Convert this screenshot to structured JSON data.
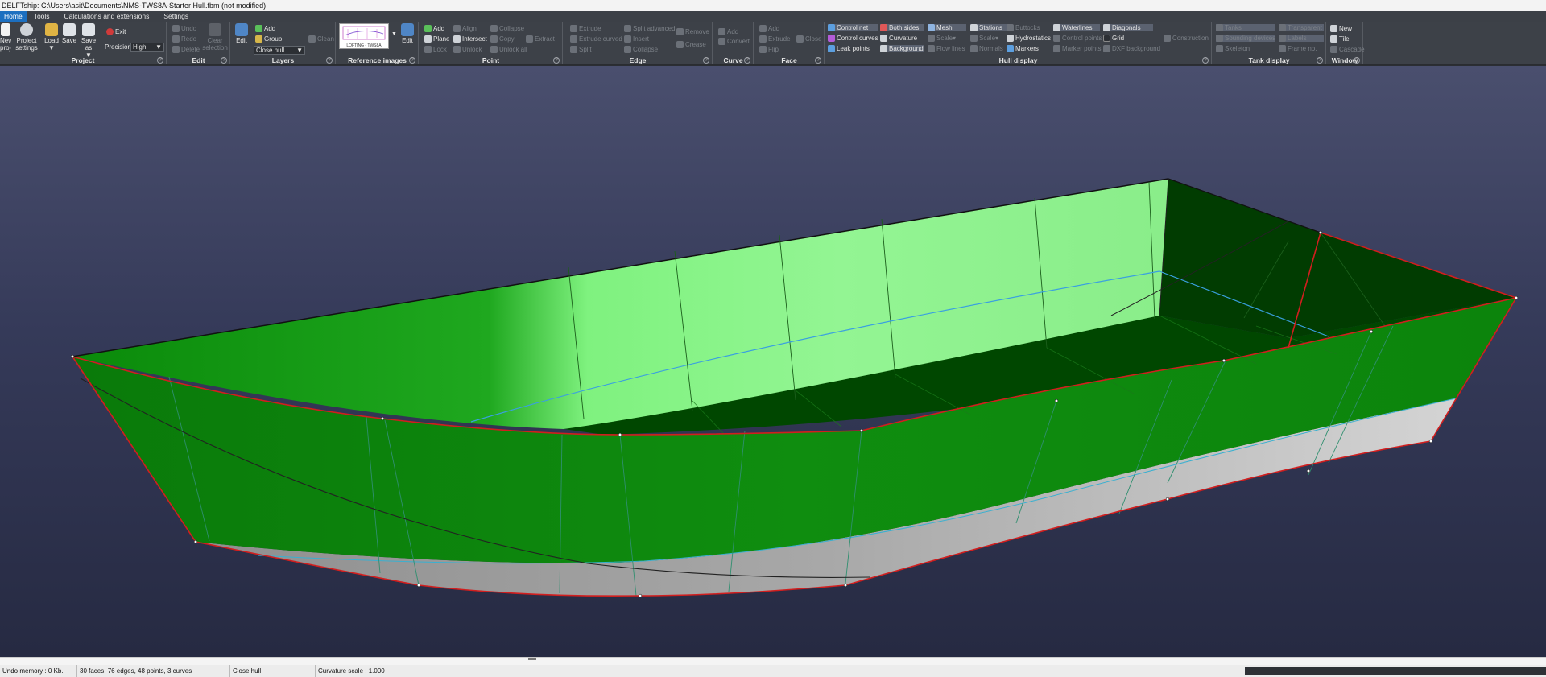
{
  "title": "DELFTship: C:\\Users\\asit\\Documents\\NMS-TWS8A-Starter Hull.fbm (not modified)",
  "menu": [
    "Home",
    "Tools",
    "Calculations and extensions",
    "Settings"
  ],
  "project": {
    "label": "Project",
    "new": "New project",
    "project_settings": "Project settings",
    "load": "Load",
    "save": "Save",
    "save_as": "Save as",
    "exit": "Exit",
    "precision_label": "Precision",
    "precision_value": "High"
  },
  "edit": {
    "label": "Edit",
    "undo": "Undo",
    "redo": "Redo",
    "delete": "Delete",
    "clear_selection": "Clear selection"
  },
  "layers": {
    "label": "Layers",
    "edit": "Edit",
    "add": "Add",
    "group": "Group",
    "clean": "Clean",
    "close_hull": "Close hull"
  },
  "reference_images": {
    "label": "Reference images",
    "thumb_caption": "LOFTING - TWS8A",
    "edit": "Edit"
  },
  "point": {
    "label": "Point",
    "add": "Add",
    "align": "Align",
    "collapse": "Collapse",
    "plane": "Plane",
    "intersect": "Intersect",
    "copy": "Copy",
    "extract": "Extract",
    "lock": "Lock",
    "unlock": "Unlock",
    "unlock_all": "Unlock all"
  },
  "edge": {
    "label": "Edge",
    "extrude": "Extrude",
    "split_advanced": "Split advanced",
    "remove": "Remove",
    "extrude_curved": "Extrude curved",
    "insert": "Insert",
    "split": "Split",
    "collapse": "Collapse",
    "crease": "Crease"
  },
  "curve": {
    "label": "Curve",
    "add": "Add",
    "convert": "Convert"
  },
  "face": {
    "label": "Face",
    "add": "Add",
    "extrude": "Extrude",
    "close": "Close",
    "flip": "Flip"
  },
  "hull_display": {
    "label": "Hull display",
    "control_net": "Control net",
    "both_sides": "Both sides",
    "mesh": "Mesh",
    "stations": "Stations",
    "buttocks": "Buttocks",
    "waterlines": "Waterlines",
    "diagonals": "Diagonals",
    "control_curves": "Control curves",
    "curvature": "Curvature",
    "scale": "Scale",
    "scale2": "Scale",
    "hydrostatics": "Hydrostatics",
    "control_points": "Control points",
    "grid": "Grid",
    "construction": "Construction",
    "leak_points": "Leak points",
    "background": "Background",
    "flow_lines": "Flow lines",
    "normals": "Normals",
    "markers": "Markers",
    "marker_points": "Marker points",
    "dxf_background": "DXF background"
  },
  "tank_display": {
    "label": "Tank display",
    "tanks": "Tanks",
    "transparent": "Transparent",
    "sounding_devices": "Sounding devices",
    "labels": "Labels",
    "skeleton": "Skeleton",
    "frame_no": "Frame no."
  },
  "window": {
    "label": "Window",
    "new": "New",
    "tile": "Tile",
    "cascade": "Cascade"
  },
  "status": {
    "memory": "Undo memory : 0 Kb.",
    "counts": "30 faces, 76 edges, 48 points, 3 curves",
    "mode": "Close hull",
    "curvature_scale": "Curvature scale : 1.000"
  },
  "colors": {
    "hull_outer": "#0a8c0a",
    "hull_inner_lit": "#8ef58e",
    "hull_inner_dark": "#003d00",
    "bottom": "#c8c8c8",
    "edge_red": "#d21e1e",
    "waterline": "#3aa0e0",
    "ribbon_bg": "#3d4148",
    "menu_active": "#1c6fc0"
  }
}
